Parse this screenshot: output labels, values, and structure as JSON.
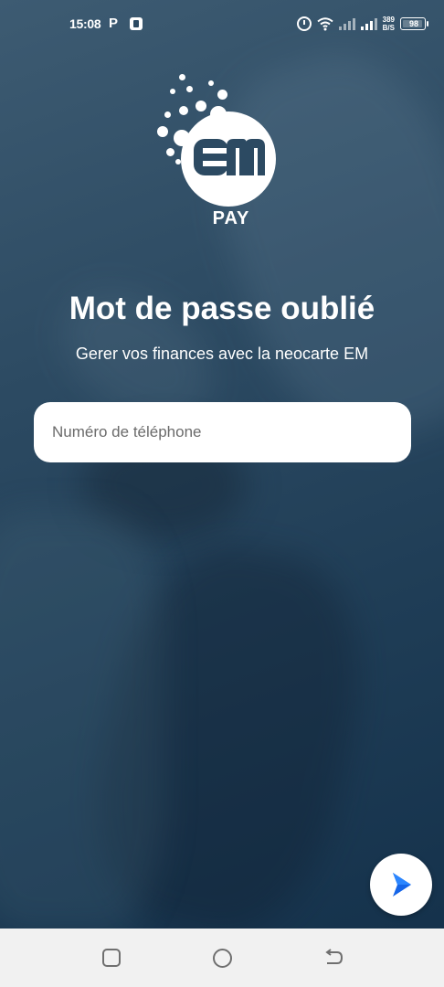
{
  "status_bar": {
    "time": "15:08",
    "notification_letter": "P",
    "net_speed_value": "389",
    "net_speed_unit": "B/S",
    "battery": "98"
  },
  "logo": {
    "letters": "EM",
    "sub_label": "PAY"
  },
  "page": {
    "title": "Mot de passe oublié",
    "subtitle": "Gerer vos finances avec la neocarte EM"
  },
  "phone_field": {
    "placeholder": "Numéro de téléphone",
    "value": ""
  },
  "colors": {
    "background": "#2c4a62",
    "accent_blue": "#1565e8",
    "input_background": "#ffffff",
    "nav_bar": "#f1f1f1"
  },
  "icons": {
    "next": "chevron-right-icon",
    "nav_recent": "square-icon",
    "nav_home": "circle-icon",
    "nav_back": "back-arrow-icon"
  }
}
